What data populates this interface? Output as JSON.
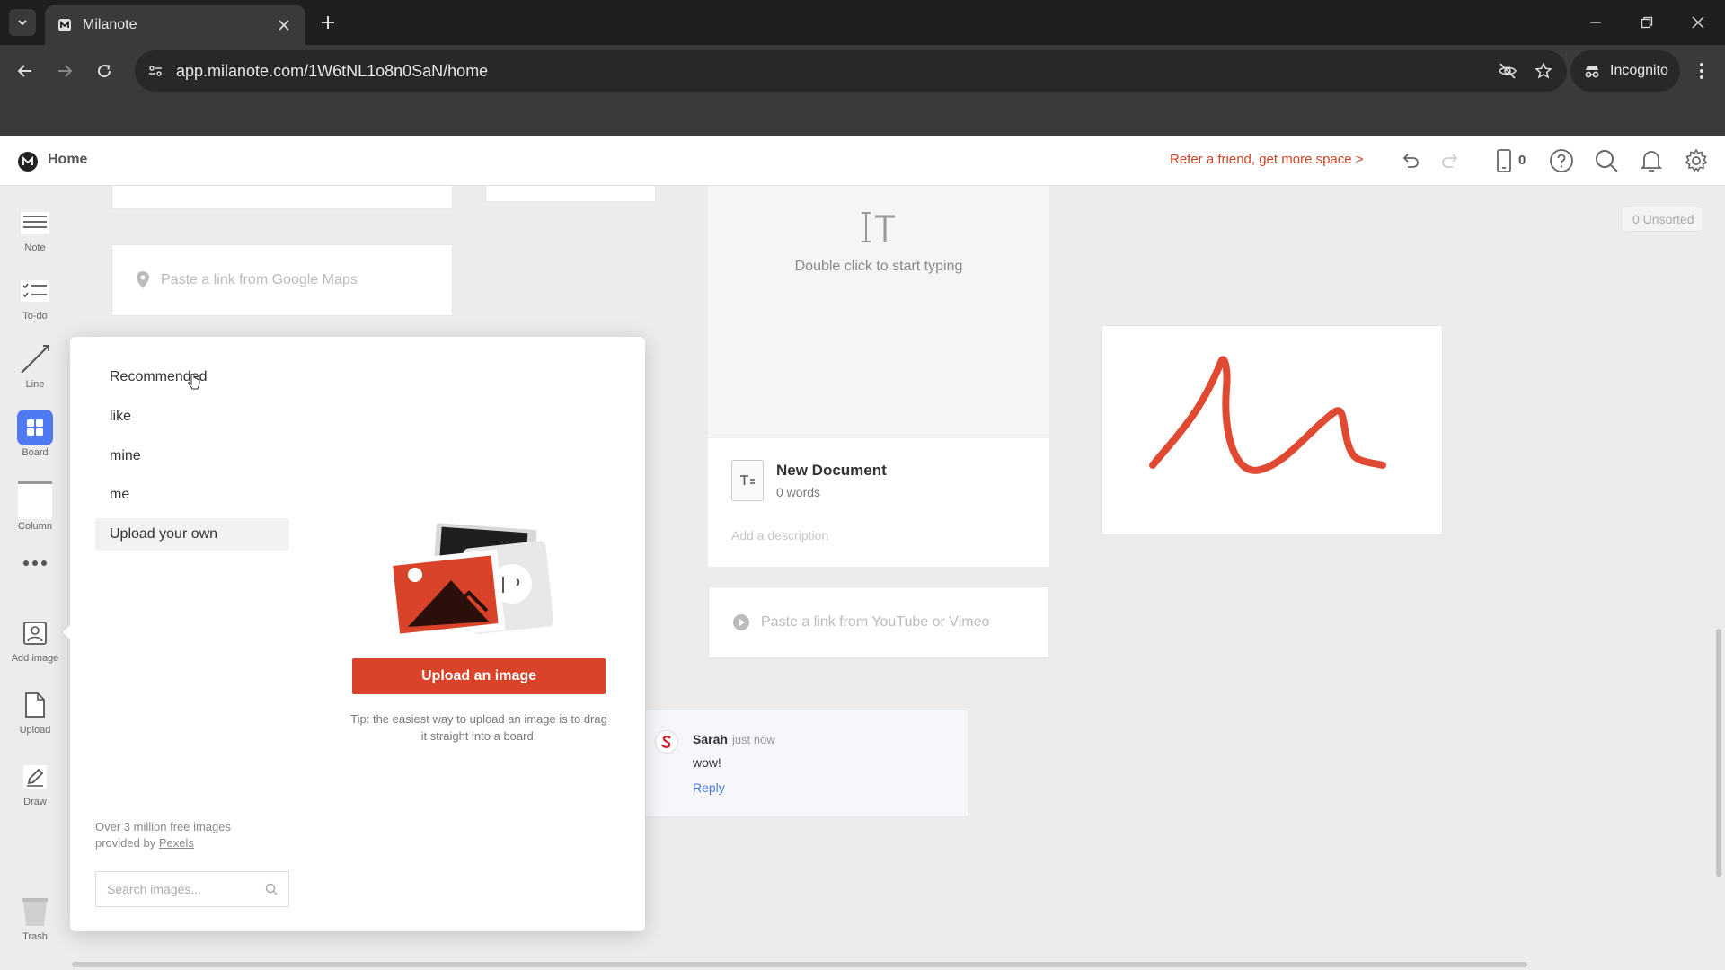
{
  "browser": {
    "tab_title": "Milanote",
    "url": "app.milanote.com/1W6tNL1o8n0SaN/home",
    "incognito_label": "Incognito"
  },
  "header": {
    "home_label": "Home",
    "refer_text": "Refer a friend, get more space >",
    "device_count": "0"
  },
  "tools": [
    {
      "label": "Note",
      "icon": "note-icon"
    },
    {
      "label": "To-do",
      "icon": "todo-icon"
    },
    {
      "label": "Line",
      "icon": "line-icon"
    },
    {
      "label": "Board",
      "icon": "board-icon"
    },
    {
      "label": "Column",
      "icon": "column-icon"
    },
    {
      "label": "",
      "icon": "more-icon"
    },
    {
      "label": "Add image",
      "icon": "add-image-icon"
    },
    {
      "label": "Upload",
      "icon": "upload-icon"
    },
    {
      "label": "Draw",
      "icon": "draw-icon"
    },
    {
      "label": "Trash",
      "icon": "trash-icon"
    }
  ],
  "canvas": {
    "map_placeholder": "Paste a link from Google Maps",
    "text_hint": "Double click to start typing",
    "document": {
      "title": "New Document",
      "words": "0 words",
      "description_placeholder": "Add a description"
    },
    "video_placeholder": "Paste a link from YouTube or Vimeo",
    "comment": {
      "author": "Sarah",
      "time": "just now",
      "text": "wow!",
      "reply": "Reply"
    },
    "unsorted": "0 Unsorted",
    "drawing_color": "#e04a32"
  },
  "image_popover": {
    "categories": [
      "Recommended",
      "like",
      "mine",
      "me",
      "Upload your own"
    ],
    "active_category": "Upload your own",
    "upload_button": "Upload an image",
    "tip": "Tip: the easiest way to upload an image is to drag it straight into a board.",
    "pexels_note": "Over 3 million free images provided by",
    "pexels_link": "Pexels",
    "search_placeholder": "Search images..."
  },
  "colors": {
    "accent": "#d9432a",
    "board_blue": "#4f7af2",
    "link_blue": "#4a7bd0"
  }
}
